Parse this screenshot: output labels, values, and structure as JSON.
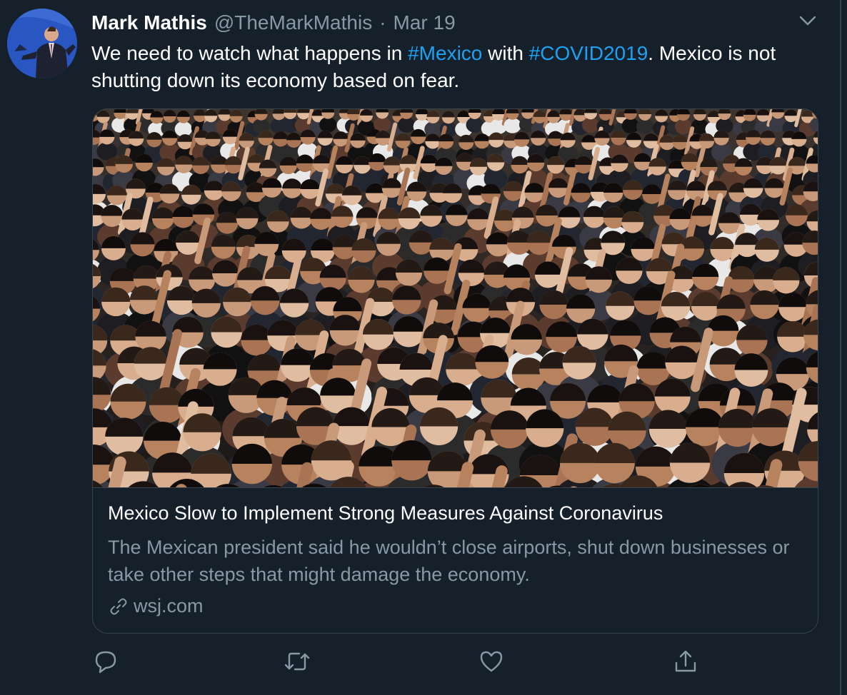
{
  "tweet": {
    "author_name": "Mark Mathis",
    "handle": "@TheMarkMathis",
    "separator": "·",
    "date": "Mar 19",
    "text_part1": "We need to watch what happens in ",
    "hashtag1": "#Mexico",
    "text_part2": " with ",
    "hashtag2": "#COVID2019",
    "text_part3": ". Mexico is not shutting down its economy based on fear."
  },
  "card": {
    "title": "Mexico Slow to Implement Strong Measures Against Coronavirus",
    "description": "The Mexican president said he wouldn’t close airports, shut down businesses or take other steps that might damage the economy.",
    "domain": "wsj.com",
    "link_icon": "link-icon"
  },
  "actions": [
    "reply-icon",
    "retweet-icon",
    "like-icon",
    "share-icon"
  ],
  "colors": {
    "background": "#15202b",
    "hashtag": "#1da1f2",
    "muted": "#8899a6",
    "border": "#38444d"
  }
}
